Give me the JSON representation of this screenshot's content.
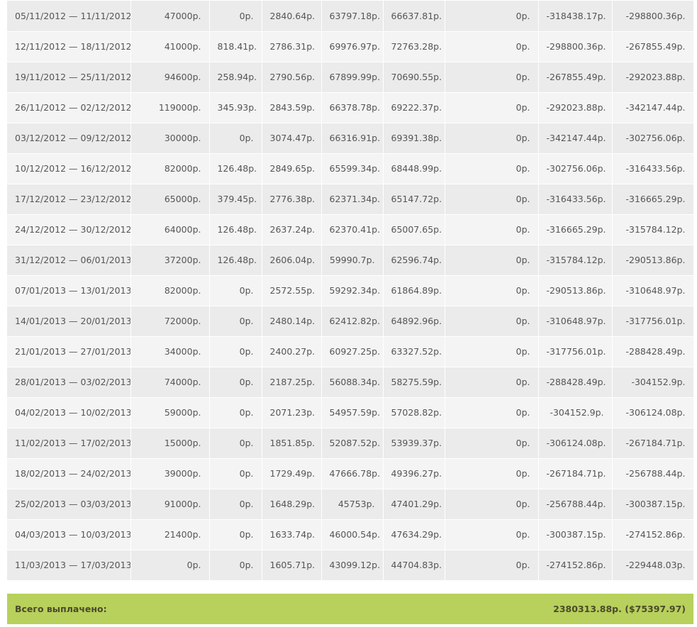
{
  "rows": [
    {
      "period": "05/11/2012 — 11/11/2012",
      "c1": "47000р.",
      "c2": "0р.",
      "c3": "2840.64р.",
      "c4": "63797.18р.",
      "c5": "66637.81р.",
      "c6": "0р.",
      "c7": "-318438.17р.",
      "c8": "-298800.36р."
    },
    {
      "period": "12/11/2012 — 18/11/2012",
      "c1": "41000р.",
      "c2": "818.41р.",
      "c3": "2786.31р.",
      "c4": "69976.97р.",
      "c5": "72763.28р.",
      "c6": "0р.",
      "c7": "-298800.36р.",
      "c8": "-267855.49р."
    },
    {
      "period": "19/11/2012 — 25/11/2012",
      "c1": "94600р.",
      "c2": "258.94р.",
      "c3": "2790.56р.",
      "c4": "67899.99р.",
      "c5": "70690.55р.",
      "c6": "0р.",
      "c7": "-267855.49р.",
      "c8": "-292023.88р."
    },
    {
      "period": "26/11/2012 — 02/12/2012",
      "c1": "119000р.",
      "c2": "345.93р.",
      "c3": "2843.59р.",
      "c4": "66378.78р.",
      "c5": "69222.37р.",
      "c6": "0р.",
      "c7": "-292023.88р.",
      "c8": "-342147.44р."
    },
    {
      "period": "03/12/2012 — 09/12/2012",
      "c1": "30000р.",
      "c2": "0р.",
      "c3": "3074.47р.",
      "c4": "66316.91р.",
      "c5": "69391.38р.",
      "c6": "0р.",
      "c7": "-342147.44р.",
      "c8": "-302756.06р."
    },
    {
      "period": "10/12/2012 — 16/12/2012",
      "c1": "82000р.",
      "c2": "126.48р.",
      "c3": "2849.65р.",
      "c4": "65599.34р.",
      "c5": "68448.99р.",
      "c6": "0р.",
      "c7": "-302756.06р.",
      "c8": "-316433.56р."
    },
    {
      "period": "17/12/2012 — 23/12/2012",
      "c1": "65000р.",
      "c2": "379.45р.",
      "c3": "2776.38р.",
      "c4": "62371.34р.",
      "c5": "65147.72р.",
      "c6": "0р.",
      "c7": "-316433.56р.",
      "c8": "-316665.29р."
    },
    {
      "period": "24/12/2012 — 30/12/2012",
      "c1": "64000р.",
      "c2": "126.48р.",
      "c3": "2637.24р.",
      "c4": "62370.41р.",
      "c5": "65007.65р.",
      "c6": "0р.",
      "c7": "-316665.29р.",
      "c8": "-315784.12р."
    },
    {
      "period": "31/12/2012 — 06/01/2013",
      "c1": "37200р.",
      "c2": "126.48р.",
      "c3": "2606.04р.",
      "c4": "59990.7р.",
      "c5": "62596.74р.",
      "c6": "0р.",
      "c7": "-315784.12р.",
      "c8": "-290513.86р."
    },
    {
      "period": "07/01/2013 — 13/01/2013",
      "c1": "82000р.",
      "c2": "0р.",
      "c3": "2572.55р.",
      "c4": "59292.34р.",
      "c5": "61864.89р.",
      "c6": "0р.",
      "c7": "-290513.86р.",
      "c8": "-310648.97р."
    },
    {
      "period": "14/01/2013 — 20/01/2013",
      "c1": "72000р.",
      "c2": "0р.",
      "c3": "2480.14р.",
      "c4": "62412.82р.",
      "c5": "64892.96р.",
      "c6": "0р.",
      "c7": "-310648.97р.",
      "c8": "-317756.01р."
    },
    {
      "period": "21/01/2013 — 27/01/2013",
      "c1": "34000р.",
      "c2": "0р.",
      "c3": "2400.27р.",
      "c4": "60927.25р.",
      "c5": "63327.52р.",
      "c6": "0р.",
      "c7": "-317756.01р.",
      "c8": "-288428.49р."
    },
    {
      "period": "28/01/2013 — 03/02/2013",
      "c1": "74000р.",
      "c2": "0р.",
      "c3": "2187.25р.",
      "c4": "56088.34р.",
      "c5": "58275.59р.",
      "c6": "0р.",
      "c7": "-288428.49р.",
      "c8": "-304152.9р."
    },
    {
      "period": "04/02/2013 — 10/02/2013",
      "c1": "59000р.",
      "c2": "0р.",
      "c3": "2071.23р.",
      "c4": "54957.59р.",
      "c5": "57028.82р.",
      "c6": "0р.",
      "c7": "-304152.9р.",
      "c8": "-306124.08р."
    },
    {
      "period": "11/02/2013 — 17/02/2013",
      "c1": "15000р.",
      "c2": "0р.",
      "c3": "1851.85р.",
      "c4": "52087.52р.",
      "c5": "53939.37р.",
      "c6": "0р.",
      "c7": "-306124.08р.",
      "c8": "-267184.71р."
    },
    {
      "period": "18/02/2013 — 24/02/2013",
      "c1": "39000р.",
      "c2": "0р.",
      "c3": "1729.49р.",
      "c4": "47666.78р.",
      "c5": "49396.27р.",
      "c6": "0р.",
      "c7": "-267184.71р.",
      "c8": "-256788.44р."
    },
    {
      "period": "25/02/2013 — 03/03/2013",
      "c1": "91000р.",
      "c2": "0р.",
      "c3": "1648.29р.",
      "c4": "45753р.",
      "c5": "47401.29р.",
      "c6": "0р.",
      "c7": "-256788.44р.",
      "c8": "-300387.15р."
    },
    {
      "period": "04/03/2013 — 10/03/2013",
      "c1": "21400р.",
      "c2": "0р.",
      "c3": "1633.74р.",
      "c4": "46000.54р.",
      "c5": "47634.29р.",
      "c6": "0р.",
      "c7": "-300387.15р.",
      "c8": "-274152.86р."
    },
    {
      "period": "11/03/2013 — 17/03/2013",
      "c1": "0р.",
      "c2": "0р.",
      "c3": "1605.71р.",
      "c4": "43099.12р.",
      "c5": "44704.83р.",
      "c6": "0р.",
      "c7": "-274152.86р.",
      "c8": "-229448.03р."
    }
  ],
  "total": {
    "label": "Всего выплачено:",
    "value": "2380313.88р. ($75397.97)"
  },
  "colors": {
    "row_odd": "#ebebeb",
    "row_even": "#f4f4f4",
    "total_bar": "#b8d05c",
    "text": "#555555"
  }
}
